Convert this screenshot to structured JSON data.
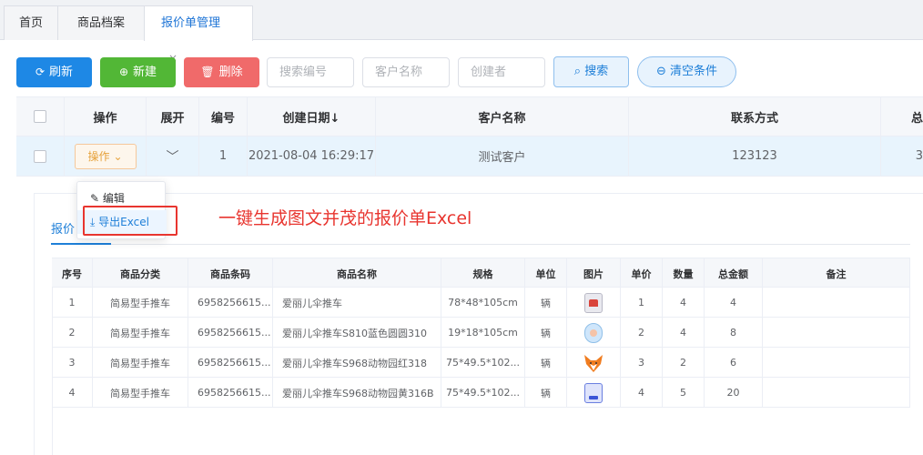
{
  "tabs": [
    {
      "label": "首页"
    },
    {
      "label": "商品档案"
    },
    {
      "label": "报价单管理",
      "close": "×"
    }
  ],
  "toolbar": {
    "refresh": "刷新",
    "new": "新建",
    "delete": "删除",
    "search_no_placeholder": "搜索编号",
    "customer_placeholder": "客户名称",
    "creator_placeholder": "创建者",
    "search": "搜索",
    "clear": "清空条件"
  },
  "main_table": {
    "headers": [
      "操作",
      "展开",
      "编号",
      "创建日期↓",
      "客户名称",
      "联系方式",
      "总"
    ],
    "row": {
      "op_label": "操作",
      "no": "1",
      "date": "2021-08-04 16:29:17",
      "customer": "测试客户",
      "contact": "123123",
      "total": "3"
    }
  },
  "dropdown": {
    "edit": "编辑",
    "export": "导出Excel"
  },
  "annotation": "一键生成图文并茂的报价单Excel",
  "panel_tab": "报价",
  "items_table": {
    "headers": [
      "序号",
      "商品分类",
      "商品条码",
      "商品名称",
      "规格",
      "单位",
      "图片",
      "单价",
      "数量",
      "总金额",
      "备注"
    ],
    "rows": [
      {
        "seq": "1",
        "category": "简易型手推车",
        "barcode": "6958256615...",
        "name": "爱丽儿伞推车",
        "spec": "78*48*105cm",
        "unit": "辆",
        "image": "stroller-red-icon",
        "price": "1",
        "qty": "4",
        "total": "4",
        "note": ""
      },
      {
        "seq": "2",
        "category": "简易型手推车",
        "barcode": "6958256615...",
        "name": "爱丽儿伞推车S810蓝色圆圆310",
        "spec": "19*18*105cm",
        "unit": "辆",
        "image": "baby-blue-icon",
        "price": "2",
        "qty": "4",
        "total": "8",
        "note": ""
      },
      {
        "seq": "3",
        "category": "简易型手推车",
        "barcode": "6958256615...",
        "name": "爱丽儿伞推车S968动物园红318",
        "spec": "75*49.5*102...",
        "unit": "辆",
        "image": "fox-icon",
        "price": "3",
        "qty": "2",
        "total": "6",
        "note": ""
      },
      {
        "seq": "4",
        "category": "简易型手推车",
        "barcode": "6958256615...",
        "name": "爱丽儿伞推车S968动物园黄316B",
        "spec": "75*49.5*102...",
        "unit": "辆",
        "image": "app-blue-icon",
        "price": "4",
        "qty": "5",
        "total": "20",
        "note": ""
      }
    ]
  },
  "colors": {
    "primary": "#1e88e5",
    "success": "#52b736",
    "danger": "#f06a6a",
    "annotation": "#e8352f"
  }
}
